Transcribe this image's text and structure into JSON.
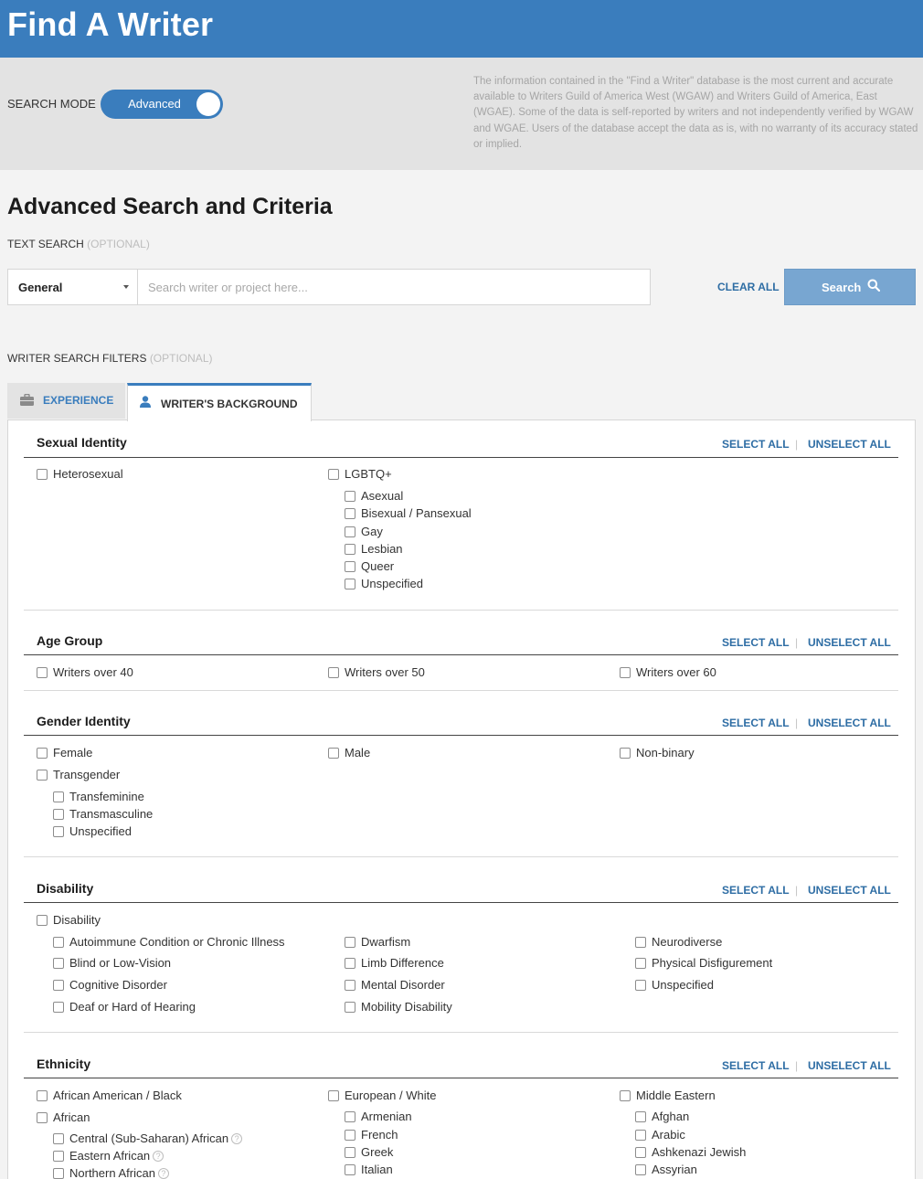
{
  "header": {
    "title": "Find A Writer"
  },
  "mode": {
    "label": "SEARCH MODE",
    "toggle_text": "Advanced",
    "disclaimer": "The information contained in the \"Find a Writer\" database is the most current and accurate available to Writers Guild of America West (WGAW) and Writers Guild of America, East (WGAE). Some of the data is self-reported by writers and not independently verified by WGAW and WGAE. Users of the database accept the data as is, with no warranty of its accuracy stated or implied."
  },
  "search": {
    "title": "Advanced Search and Criteria",
    "text_search_label": "TEXT SEARCH",
    "optional": "(OPTIONAL)",
    "dropdown_value": "General",
    "placeholder": "Search writer or project here...",
    "clear_all": "CLEAR ALL",
    "search_button": "Search"
  },
  "filters": {
    "label": "WRITER SEARCH FILTERS",
    "optional": "(OPTIONAL)",
    "tabs": [
      {
        "label": "EXPERIENCE",
        "icon": "briefcase-icon"
      },
      {
        "label": "WRITER'S BACKGROUND",
        "icon": "user-icon"
      }
    ],
    "select_all": "SELECT ALL",
    "unselect_all": "UNSELECT ALL"
  },
  "groups": {
    "sexual_identity": {
      "title": "Sexual Identity",
      "heterosexual": "Heterosexual",
      "lgbtq": "LGBTQ+",
      "lgbtq_sub": [
        "Asexual",
        "Bisexual / Pansexual",
        "Gay",
        "Lesbian",
        "Queer",
        "Unspecified"
      ]
    },
    "age_group": {
      "title": "Age Group",
      "options": [
        "Writers over 40",
        "Writers over 50",
        "Writers over 60"
      ]
    },
    "gender_identity": {
      "title": "Gender Identity",
      "options": [
        "Female",
        "Male",
        "Non-binary"
      ],
      "transgender": "Transgender",
      "transgender_sub": [
        "Transfeminine",
        "Transmasculine",
        "Unspecified"
      ]
    },
    "disability": {
      "title": "Disability",
      "parent": "Disability",
      "col1": [
        "Autoimmune Condition or Chronic Illness",
        "Blind or Low-Vision",
        "Cognitive Disorder",
        "Deaf or Hard of Hearing"
      ],
      "col2": [
        "Dwarfism",
        "Limb Difference",
        "Mental Disorder",
        "Mobility Disability"
      ],
      "col3": [
        "Neurodiverse",
        "Physical Disfigurement",
        "Unspecified"
      ]
    },
    "ethnicity": {
      "title": "Ethnicity",
      "african_american": "African American / Black",
      "african": "African",
      "african_sub": [
        "Central (Sub-Saharan) African",
        "Eastern African",
        "Northern African"
      ],
      "european": "European / White",
      "european_sub": [
        "Armenian",
        "French",
        "Greek",
        "Italian"
      ],
      "middle_eastern": "Middle Eastern",
      "middle_eastern_sub": [
        "Afghan",
        "Arabic",
        "Ashkenazi Jewish",
        "Assyrian"
      ],
      "help_glyph": "?"
    }
  }
}
